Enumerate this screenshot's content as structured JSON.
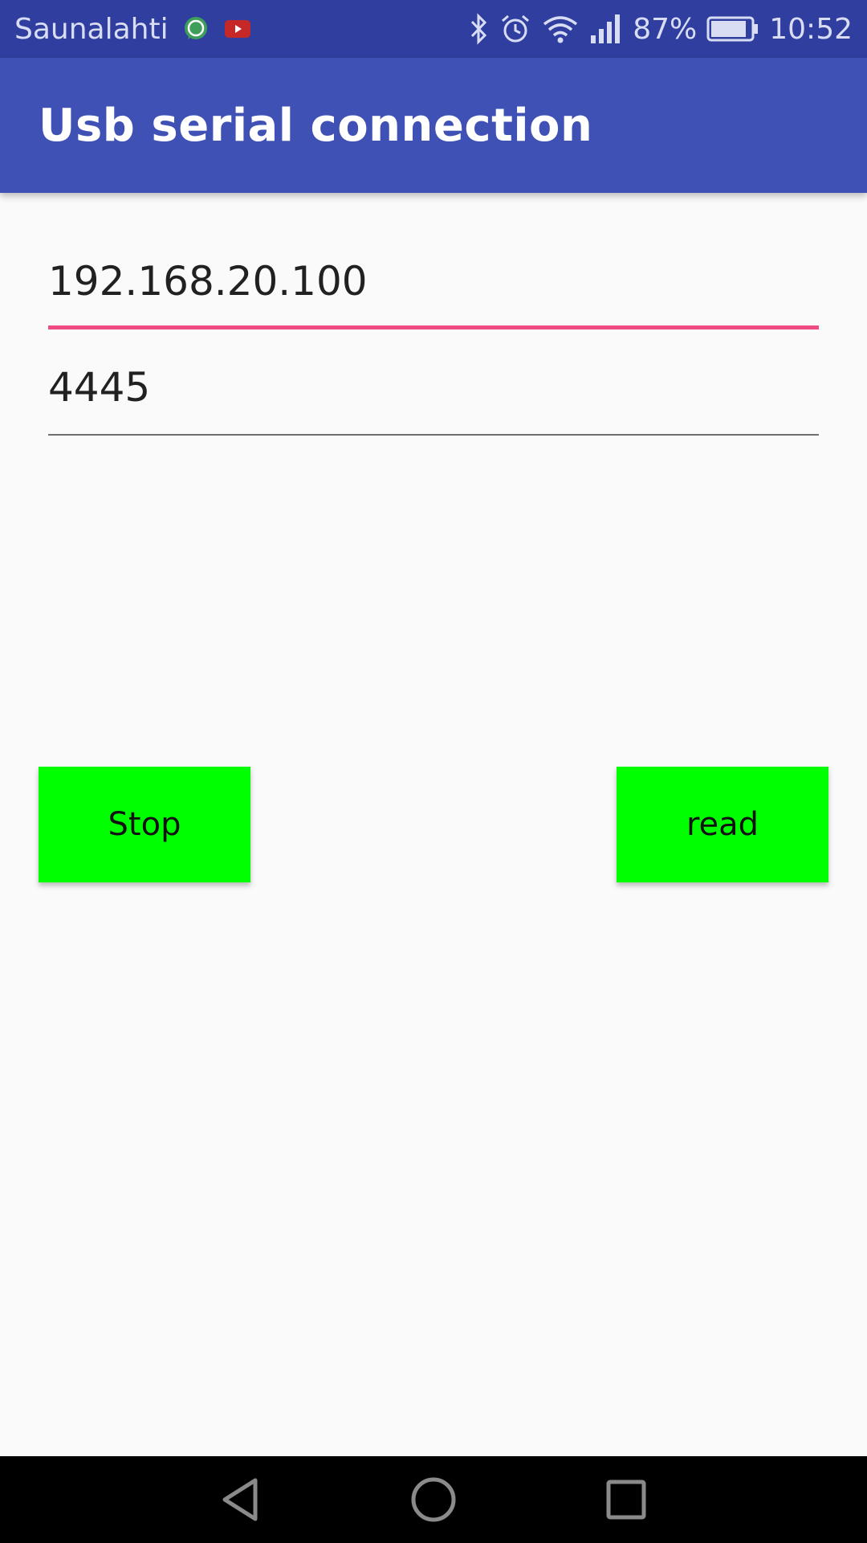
{
  "status_bar": {
    "carrier": "Saunalahti",
    "battery": "87%",
    "time": "10:52",
    "icons_left": [
      "whatsapp-icon",
      "youtube-icon"
    ],
    "icons_right": [
      "bluetooth-icon",
      "alarm-icon",
      "wifi-icon",
      "signal-icon",
      "battery-icon"
    ]
  },
  "app_bar": {
    "title": "Usb serial connection"
  },
  "form": {
    "ip_value": "192.168.20.100",
    "port_value": "4445"
  },
  "buttons": {
    "stop_label": "Stop",
    "read_label": "read"
  },
  "nav_bar": {
    "icons": [
      "back-icon",
      "home-icon",
      "recents-icon"
    ]
  },
  "colors": {
    "status_bar": "#303f9f",
    "app_bar": "#3f51b5",
    "accent": "#ee4b84",
    "button": "#00ff00",
    "background": "#fafafa"
  }
}
